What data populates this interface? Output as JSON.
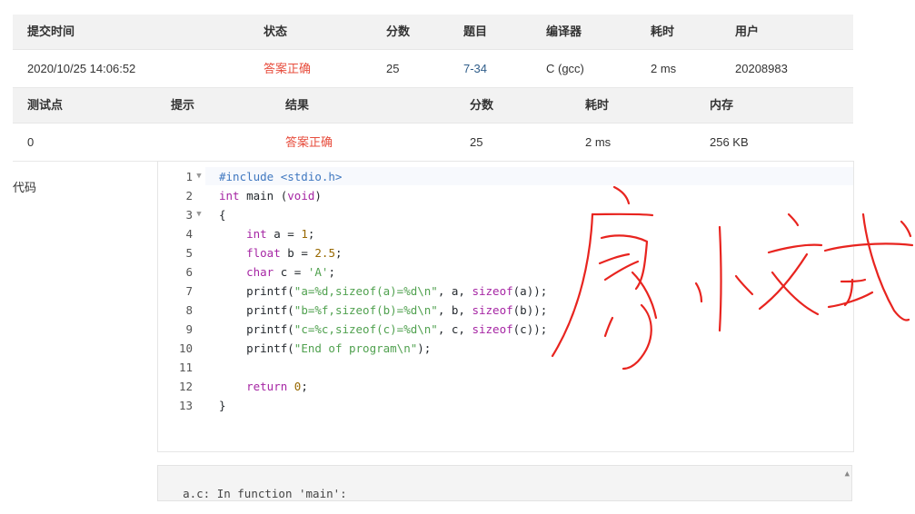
{
  "submission": {
    "headers": [
      "提交时间",
      "状态",
      "分数",
      "题目",
      "编译器",
      "耗时",
      "用户"
    ],
    "row": {
      "time": "2020/10/25 14:06:52",
      "status": "答案正确",
      "score": "25",
      "problem": "7-34",
      "compiler": "C (gcc)",
      "elapsed": "2 ms",
      "user": "20208983"
    }
  },
  "testcases": {
    "headers": [
      "测试点",
      "提示",
      "结果",
      "分数",
      "耗时",
      "内存"
    ],
    "rows": [
      {
        "id": "0",
        "hint": "",
        "result": "答案正确",
        "score": "25",
        "elapsed": "2 ms",
        "memory": "256 KB"
      }
    ]
  },
  "code": {
    "label": "代码",
    "line_numbers": [
      "1",
      "2",
      "3",
      "4",
      "5",
      "6",
      "7",
      "8",
      "9",
      "10",
      "11",
      "12",
      "13"
    ],
    "lines": [
      "#include <stdio.h>",
      "int main (void)",
      "{",
      "    int a = 1;",
      "    float b = 2.5;",
      "    char c = 'A';",
      "    printf(\"a=%d,sizeof(a)=%d\\n\", a, sizeof(a));",
      "    printf(\"b=%f,sizeof(b)=%d\\n\", b, sizeof(b));",
      "    printf(\"c=%c,sizeof(c)=%d\\n\", c, sizeof(c));",
      "    printf(\"End of program\\n\");",
      "    ",
      "    return 0;",
      "}"
    ]
  },
  "compiler_output": "a.c: In function 'main':",
  "colors": {
    "accepted": "#e74c3c",
    "link": "#2f5d8a",
    "header_bg": "#f2f2f2",
    "watermark": "#e8241f"
  }
}
